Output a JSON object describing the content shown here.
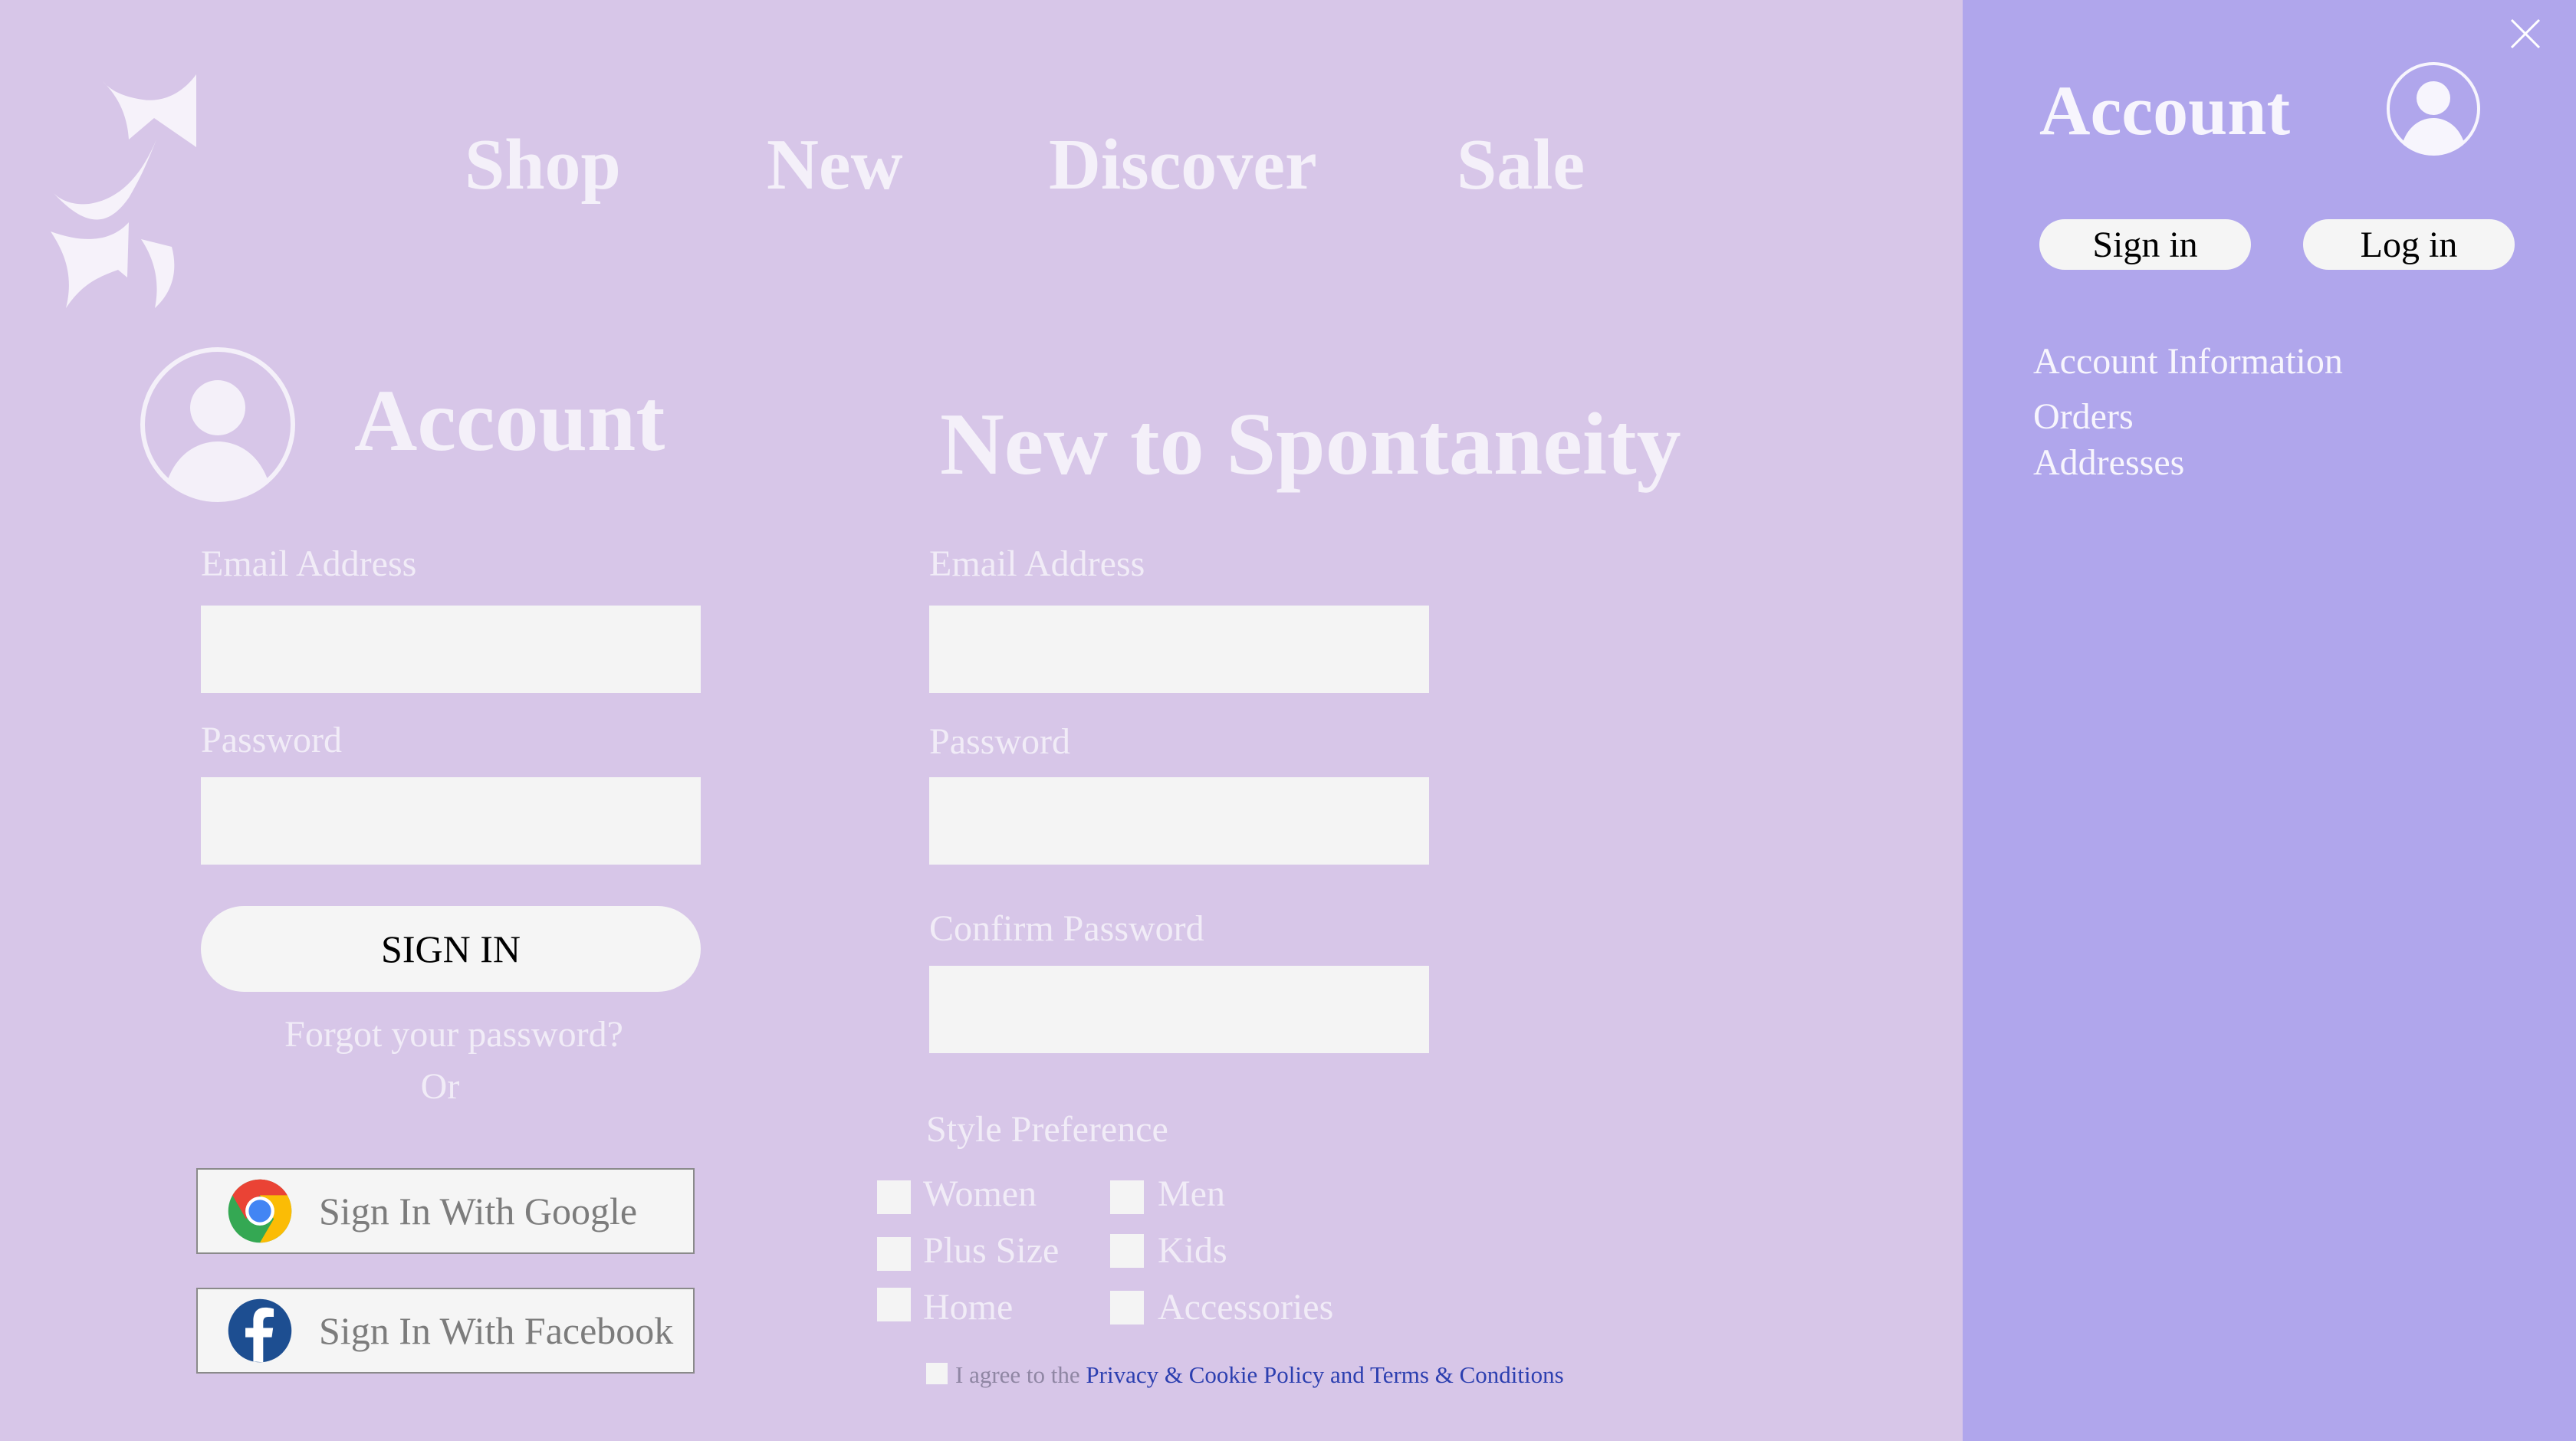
{
  "nav": {
    "items": [
      {
        "label": "Shop"
      },
      {
        "label": "New"
      },
      {
        "label": "Discover"
      },
      {
        "label": "Sale"
      }
    ]
  },
  "signin": {
    "title": "Account",
    "email_label": "Email Address",
    "email_value": "",
    "password_label": "Password",
    "password_value": "",
    "submit_label": "SIGN IN",
    "forgot_label": "Forgot your password?",
    "or_label": "Or",
    "google_label": "Sign In With Google",
    "facebook_label": "Sign In With Facebook"
  },
  "register": {
    "title": "New to Spontaneity",
    "email_label": "Email Address",
    "email_value": "",
    "password_label": "Password",
    "password_value": "",
    "confirm_label": "Confirm Password",
    "confirm_value": "",
    "style_label": "Style Preference",
    "styles": {
      "women": "Women",
      "men": "Men",
      "plus": "Plus Size",
      "kids": "Kids",
      "home": "Home",
      "accessories": "Accessories"
    },
    "agree_prefix": "I agree to the",
    "agree_link": "Privacy & Cookie Policy and Terms & Conditions"
  },
  "panel": {
    "title": "Account",
    "signin_label": "Sign in",
    "login_label": "Log in",
    "links": {
      "info": "Account Information",
      "orders": "Orders",
      "addresses": "Addresses"
    }
  },
  "colors": {
    "page_bg": "#d7c6e8",
    "panel_bg": "#b0a6ec",
    "field_bg": "#f4f4f4",
    "link": "#2c3fb0"
  },
  "icons": {
    "logo": "brand-logo",
    "avatar": "user-avatar-icon",
    "close": "close-icon",
    "google": "chrome-icon",
    "facebook": "facebook-icon"
  }
}
